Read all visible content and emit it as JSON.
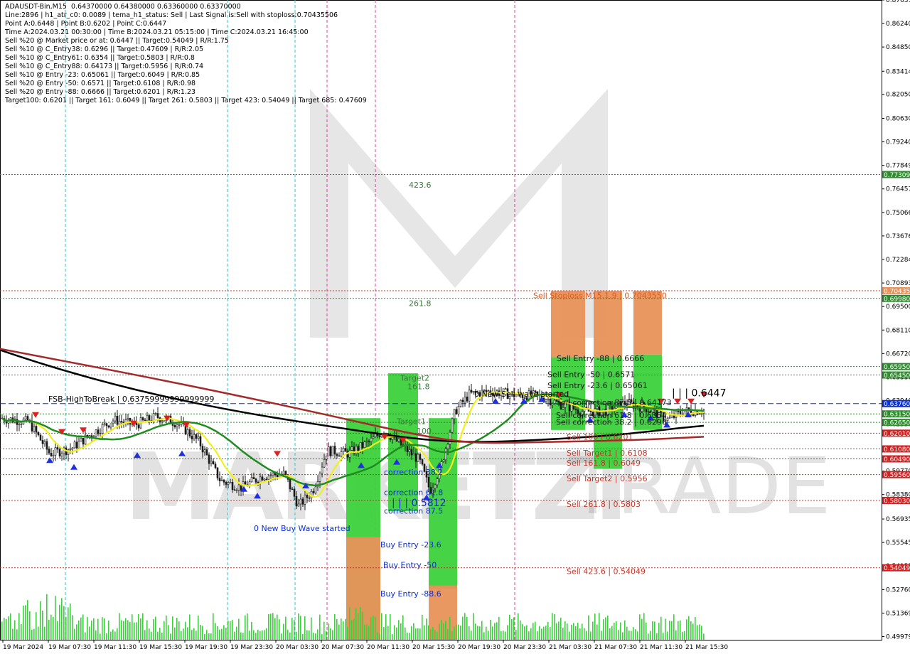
{
  "info_lines": [
    "ADAUSDT-Bin,M15  0.64370000 0.64380000 0.63360000 0.63370000",
    "Line:2896 | h1_atr_c0: 0.0089 | tema_h1_status: Sell | Last Signal is:Sell with stoploss:0.70435506",
    "Point A:0.6448 | Point B:0.6202 | Point C:0.6447",
    "Time A:2024.03.21 00:30:00 | Time B:2024.03.21 05:15:00 | Time C:2024.03.21 16:45:00",
    "Sell %20 @ Market price or at: 0.6447 || Target:0.54049 | R/R:1.75",
    "Sell %10 @ C_Entry38: 0.6296 || Target:0.47609 | R/R:2.05",
    "Sell %10 @ C_Entry61: 0.6354 || Target:0.5803 | R/R:0.8",
    "Sell %10 @ C_Entry88: 0.64173 || Target:0.5956 | R/R:0.74",
    "Sell %10 @ Entry -23: 0.65061 || Target:0.6049 | R/R:0.85",
    "Sell %20 @ Entry -50: 0.6571 || Target:0.6108 | R/R:0.98",
    "Sell %20 @ Entry -88: 0.6666 || Target:0.6201 | R/R:1.23",
    "Target100: 0.6201 || Target 161: 0.6049 || Target 261: 0.5803 || Target 423: 0.54049 || Target 685: 0.47609"
  ],
  "watermark": {
    "logo_text": "MARKETZI",
    "suffix": "TRADE"
  },
  "colors": {
    "bull": "#1a1a1a",
    "bear": "#1a1a1a",
    "sma_fast": "#f2ef1e",
    "sma_mid": "#1f8c1f",
    "sma_slow": "#000000",
    "sma_long": "#a52a2a",
    "green_zone": "#3cd13c",
    "orange_zone": "#e8925a",
    "level_red": "#c0392b",
    "level_green": "#2e8b2e",
    "current": "#0a2fd6"
  },
  "chart_data": {
    "type": "candlestick",
    "symbol": "ADAUSDT-Bin",
    "timeframe": "M15",
    "ylim": [
      0.4979,
      0.8763
    ],
    "y_ticks": [
      "0.87631",
      "0.86240",
      "0.84850",
      "0.83414",
      "0.82050",
      "0.80630",
      "0.79240",
      "0.77849",
      "0.76457",
      "0.75066",
      "0.73676",
      "0.72284",
      "0.70893",
      "0.69500",
      "0.68110",
      "0.66720",
      "0.65330",
      "0.63940",
      "0.62550",
      "0.61150",
      "0.59770",
      "0.58380",
      "0.56935",
      "0.55545",
      "0.54155",
      "0.52760",
      "0.51369",
      "0.49979"
    ],
    "x_ticks": [
      "19 Mar 2024",
      "19 Mar 07:30",
      "19 Mar 11:30",
      "19 Mar 15:30",
      "19 Mar 19:30",
      "19 Mar 23:30",
      "20 Mar 03:30",
      "20 Mar 07:30",
      "20 Mar 11:30",
      "20 Mar 15:30",
      "20 Mar 19:30",
      "20 Mar 23:30",
      "21 Mar 03:30",
      "21 Mar 07:30",
      "21 Mar 11:30",
      "21 Mar 15:30"
    ],
    "price_tags": [
      {
        "text": "0.77309",
        "value": 0.77309,
        "color": "#2e8b2e"
      },
      {
        "text": "0.70435",
        "value": 0.70435,
        "color": "#e8925a"
      },
      {
        "text": "0.69980",
        "value": 0.6998,
        "color": "#2e8b2e"
      },
      {
        "text": "0.65950",
        "value": 0.6595,
        "color": "#2e8b2e"
      },
      {
        "text": "0.65450",
        "value": 0.6545,
        "color": "#2e8b2e"
      },
      {
        "text": "0.63760",
        "value": 0.6376,
        "color": "#0a2fd6"
      },
      {
        "text": "0.63150",
        "value": 0.6315,
        "color": "#2e8b2e"
      },
      {
        "text": "0.62650",
        "value": 0.6265,
        "color": "#2e8b2e"
      },
      {
        "text": "0.62010",
        "value": 0.6201,
        "color": "#d02020"
      },
      {
        "text": "0.61080",
        "value": 0.6108,
        "color": "#d02020"
      },
      {
        "text": "0.60490",
        "value": 0.6049,
        "color": "#d02020"
      },
      {
        "text": "0.59560",
        "value": 0.5956,
        "color": "#d02020"
      },
      {
        "text": "0.58030",
        "value": 0.5803,
        "color": "#d02020"
      },
      {
        "text": "0.54049",
        "value": 0.54049,
        "color": "#d02020"
      }
    ],
    "levels": [
      {
        "value": 0.77309,
        "color": "#2e8b2e"
      },
      {
        "value": 0.70435,
        "color": "#c0392b"
      },
      {
        "value": 0.6998,
        "color": "#2e8b2e"
      },
      {
        "value": 0.6595,
        "color": "#2e8b2e"
      },
      {
        "value": 0.6545,
        "color": "#2e8b2e"
      },
      {
        "value": 0.6376,
        "color": "#0a2fd6"
      },
      {
        "value": 0.6315,
        "color": "#2e8b2e"
      },
      {
        "value": 0.6265,
        "color": "#2e8b2e"
      },
      {
        "value": 0.6201,
        "color": "#c0392b"
      },
      {
        "value": 0.6108,
        "color": "#c0392b"
      },
      {
        "value": 0.6049,
        "color": "#c0392b"
      },
      {
        "value": 0.5956,
        "color": "#c0392b"
      },
      {
        "value": 0.5803,
        "color": "#c0392b"
      },
      {
        "value": 0.54049,
        "color": "#c0392b"
      }
    ],
    "annotations": [
      {
        "text": "423.6",
        "value": 0.7654,
        "color": "#3b7a3b"
      },
      {
        "text": "261.8",
        "value": 0.6952,
        "color": "#3b7a3b"
      },
      {
        "text": "Target2",
        "value": 0.6512,
        "color": "#3b7a3b"
      },
      {
        "text": "161.8",
        "value": 0.6462,
        "color": "#3b7a3b"
      },
      {
        "text": "Target1",
        "value": 0.6254,
        "color": "#3b7a3b"
      },
      {
        "text": "100",
        "value": 0.6198,
        "color": "#3b7a3b"
      },
      {
        "text": "FSB-HighToBreak | 0.63759999999999999",
        "value": 0.6388,
        "color": "#000000"
      },
      {
        "text": "0 New Sell wave started",
        "value": 0.6417,
        "color": "#000000"
      },
      {
        "text": "0 New Buy Wave started",
        "value": 0.5623,
        "color": "#0a2fd6"
      },
      {
        "text": "Sell Stoploss M15.1.9 | 0.7043550",
        "value": 0.7,
        "color": "#e05a20"
      },
      {
        "text": "Sell Entry -88 | 0.6666",
        "value": 0.6628,
        "color": "#1a1a1a"
      },
      {
        "text": "Sell Entry -50 | 0.6571",
        "value": 0.6533,
        "color": "#1a1a1a"
      },
      {
        "text": "Sell Entry -23.6 | 0.65061",
        "value": 0.6468,
        "color": "#1a1a1a"
      },
      {
        "text": "Sell 100 | 0.6201",
        "value": 0.6162,
        "color": "#c0392b"
      },
      {
        "text": "Sell Target1 | 0.6108",
        "value": 0.6069,
        "color": "#c0392b"
      },
      {
        "text": "Sell 161.8 | 0.6049",
        "value": 0.601,
        "color": "#c0392b"
      },
      {
        "text": "Sell Target2 | 0.5956",
        "value": 0.5917,
        "color": "#c0392b"
      },
      {
        "text": "Sell 261.8 | 0.5803",
        "value": 0.5765,
        "color": "#c0392b"
      },
      {
        "text": "Sell  423.6 | 0.54049",
        "value": 0.5367,
        "color": "#c0392b"
      },
      {
        "text": "correction 38.2",
        "value": 0.5955,
        "color": "#0a2fd6"
      },
      {
        "text": "correction 61.8",
        "value": 0.5835,
        "color": "#0a2fd6"
      },
      {
        "text": "correction 87.5",
        "value": 0.5725,
        "color": "#0a2fd6"
      },
      {
        "text": "| | | 0.5812",
        "value": 0.577,
        "color": "#0a2fd6"
      },
      {
        "text": "Buy Entry -23.6",
        "value": 0.5525,
        "color": "#0a2fd6"
      },
      {
        "text": "Buy Entry -50",
        "value": 0.5405,
        "color": "#0a2fd6"
      },
      {
        "text": "Buy Entry -88.6",
        "value": 0.5235,
        "color": "#0a2fd6"
      },
      {
        "text": "| | | 0.6447",
        "value": 0.642,
        "color": "#000000"
      },
      {
        "text": "Sell correction 87.5 | 0.64173",
        "value": 0.6367,
        "color": "#1a1a1a"
      },
      {
        "text": "Sell correction 61.8 | 0.6354",
        "value": 0.629,
        "color": "#1a1a1a"
      },
      {
        "text": "Sell correction 38.2 | 0.6296",
        "value": 0.625,
        "color": "#1a1a1a"
      }
    ],
    "grid": false
  }
}
